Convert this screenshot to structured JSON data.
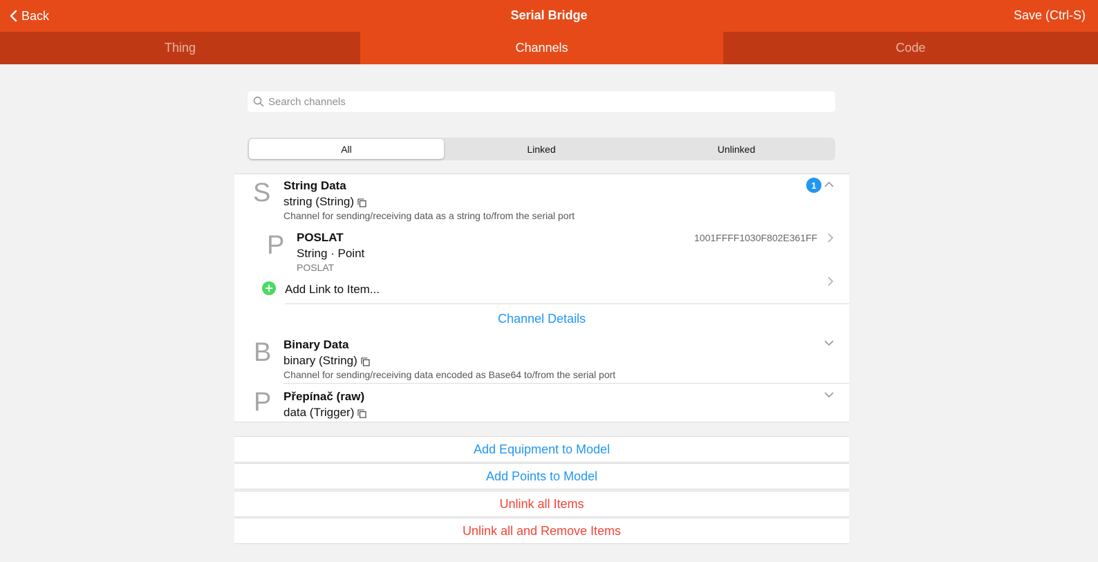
{
  "navbar": {
    "back_label": "Back",
    "title": "Serial Bridge",
    "save_label": "Save (Ctrl-S)"
  },
  "tabs": [
    {
      "label": "Thing",
      "active": false
    },
    {
      "label": "Channels",
      "active": true
    },
    {
      "label": "Code",
      "active": false
    }
  ],
  "search": {
    "placeholder": "Search channels",
    "value": ""
  },
  "filter": {
    "options": [
      "All",
      "Linked",
      "Unlinked"
    ],
    "selected": "All"
  },
  "channels": [
    {
      "letter": "S",
      "title": "String Data",
      "subtitle": "string (String)",
      "description": "Channel for sending/receiving data as a string to/from the serial port",
      "badge": "1",
      "expanded": true,
      "links": [
        {
          "letter": "P",
          "title": "POSLAT",
          "subtitle": "String · Point",
          "footer": "POSLAT",
          "value": "1001FFFF1030F802E361FF"
        }
      ],
      "add_link_label": "Add Link to Item...",
      "details_label": "Channel Details"
    },
    {
      "letter": "B",
      "title": "Binary Data",
      "subtitle": "binary (String)",
      "description": "Channel for sending/receiving data encoded as Base64 to/from the serial port",
      "expanded": false
    },
    {
      "letter": "P",
      "title": "Přepínač (raw)",
      "subtitle": "data (Trigger)",
      "expanded": false
    }
  ],
  "actions": [
    {
      "label": "Add Equipment to Model",
      "color": "#2196f3"
    },
    {
      "label": "Add Points to Model",
      "color": "#2196f3"
    },
    {
      "label": "Unlink all Items",
      "color": "#f44336"
    },
    {
      "label": "Unlink all and Remove Items",
      "color": "#f44336"
    }
  ],
  "colors": {
    "navbar": "#e64a19",
    "tabbar": "#bf3a14",
    "accent_blue": "#2196f3",
    "danger_red": "#f44336",
    "add_green": "#4cd964"
  },
  "icons": [
    "chevron-left-icon",
    "search-icon",
    "copy-icon",
    "chevron-up-icon",
    "chevron-down-icon",
    "chevron-right-icon",
    "plus-icon"
  ]
}
